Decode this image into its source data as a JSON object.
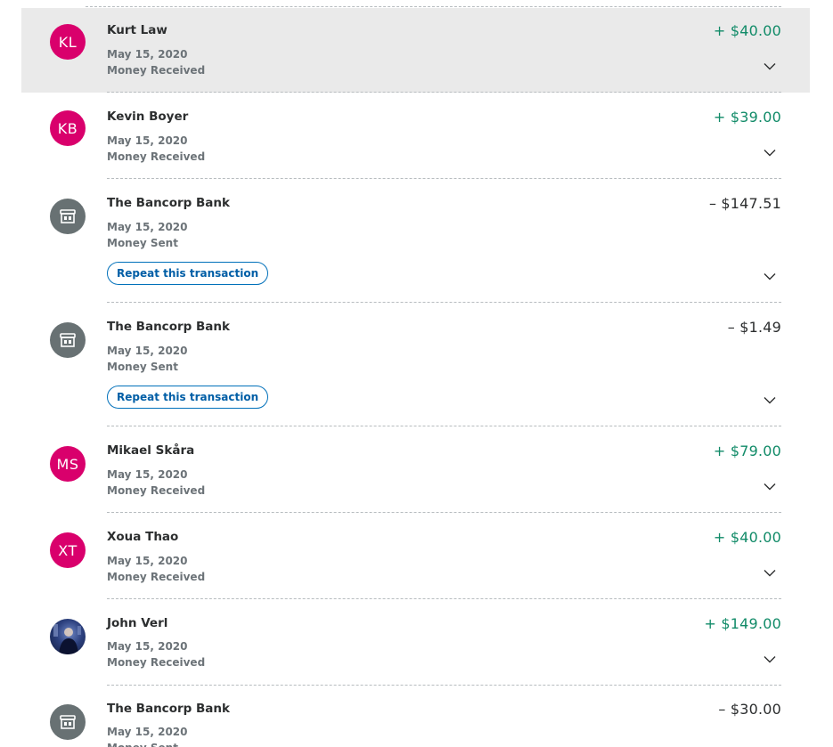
{
  "transactions": [
    {
      "initials": "KL",
      "avatar_kind": "initials",
      "name": "Kurt Law",
      "date": "May 15, 2020",
      "type": "Money Received",
      "amount": "+ $40.00",
      "direction": "in",
      "highlighted": true
    },
    {
      "initials": "KB",
      "avatar_kind": "initials",
      "name": "Kevin Boyer",
      "date": "May 15, 2020",
      "type": "Money Received",
      "amount": "+ $39.00",
      "direction": "in"
    },
    {
      "avatar_kind": "bank",
      "name": "The Bancorp Bank",
      "date": "May 15, 2020",
      "type": "Money Sent",
      "amount": "– $147.51",
      "direction": "out",
      "action": "Repeat this transaction"
    },
    {
      "avatar_kind": "bank",
      "name": "The Bancorp Bank",
      "date": "May 15, 2020",
      "type": "Money Sent",
      "amount": "– $1.49",
      "direction": "out",
      "action": "Repeat this transaction"
    },
    {
      "initials": "MS",
      "avatar_kind": "initials",
      "name": "Mikael Skåra",
      "date": "May 15, 2020",
      "type": "Money Received",
      "amount": "+ $79.00",
      "direction": "in"
    },
    {
      "initials": "XT",
      "avatar_kind": "initials",
      "name": "Xoua Thao",
      "date": "May 15, 2020",
      "type": "Money Received",
      "amount": "+ $40.00",
      "direction": "in"
    },
    {
      "avatar_kind": "photo",
      "name": "John Verl",
      "date": "May 15, 2020",
      "type": "Money Received",
      "amount": "+ $149.00",
      "direction": "in"
    },
    {
      "avatar_kind": "bank",
      "name": "The Bancorp Bank",
      "date": "May 15, 2020",
      "type": "Money Sent",
      "amount": "– $30.00",
      "direction": "out"
    }
  ],
  "colors": {
    "received": "#118b68",
    "sent": "#2c2e2f",
    "avatar_initials": "#d9006c",
    "avatar_bank": "#687173",
    "highlight_row": "#eaeaea",
    "link": "#0070ba"
  },
  "icons": {
    "bank_avatar": "storefront-icon",
    "expand": "chevron-down-icon"
  }
}
